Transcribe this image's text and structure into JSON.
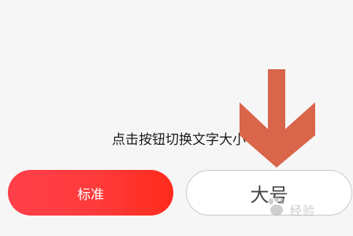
{
  "hint": {
    "text": "点击按钮切换文字大小"
  },
  "buttons": {
    "standard_label": "标准",
    "large_label": "大号"
  },
  "overlay": {
    "arrow_color": "#d9654a",
    "arrow_direction": "down",
    "watermark_text": "经验",
    "watermark_icon": "baidu-paw-icon"
  },
  "colors": {
    "accent_red": "#ff3a3a",
    "background": "#f6f6f6"
  }
}
